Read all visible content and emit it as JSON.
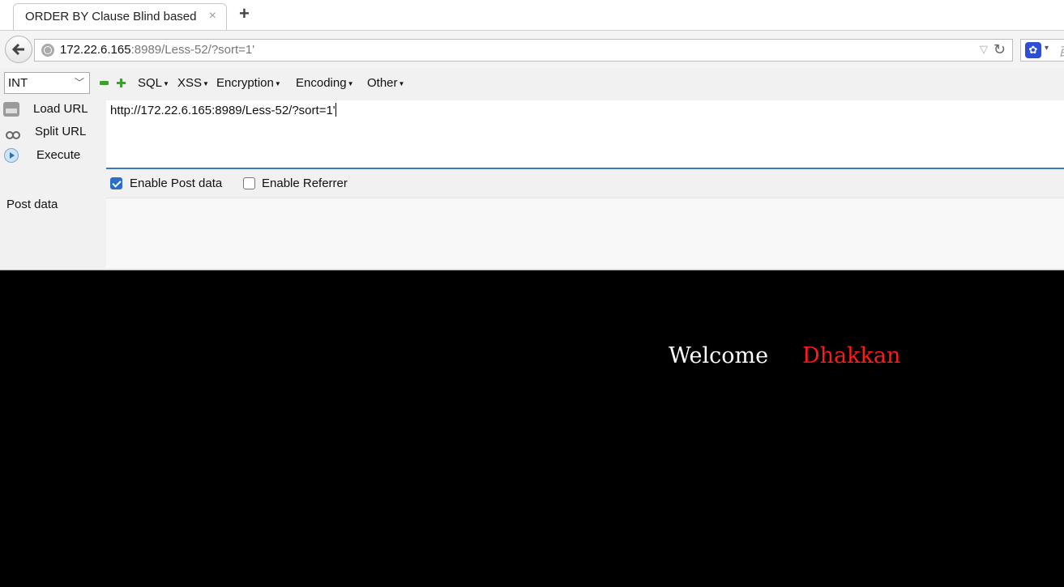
{
  "tab": {
    "title": "ORDER BY Clause Blind based",
    "close": "×",
    "new_tab": "+"
  },
  "address_bar": {
    "host": "172.22.6.165",
    "rest": ":8989/Less-52/?sort=1'",
    "dropdown": "▽",
    "reload": "↻"
  },
  "search": {
    "engine_icon": "baidu-paw-icon",
    "dropdown": "▾",
    "hint": "百"
  },
  "hackbar": {
    "type_select": "INT",
    "menus": [
      "SQL",
      "XSS",
      "Encryption",
      "Encoding",
      "Other"
    ],
    "side_buttons": {
      "load_url": "Load URL",
      "split_url": "Split URL",
      "execute": "Execute"
    },
    "url_value": "http://172.22.6.165:8989/Less-52/?sort=1'",
    "enable_post": {
      "label": "Enable Post data",
      "checked": true
    },
    "enable_referrer": {
      "label": "Enable Referrer",
      "checked": false
    },
    "post_label": "Post data",
    "post_value": ""
  },
  "page": {
    "welcome": "Welcome",
    "name": "Dhakkan",
    "name_color": "#ff1a1a"
  }
}
